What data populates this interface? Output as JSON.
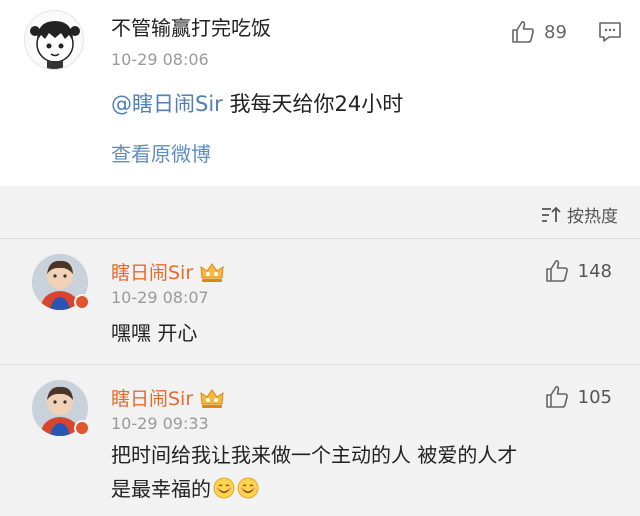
{
  "post": {
    "author": "不管输赢打完吃饭",
    "time": "10-29 08:06",
    "likes": "89",
    "mention": "@瞎日闹Sir",
    "body": " 我每天给你24小时",
    "view_original": "查看原微博"
  },
  "sort": {
    "label": "按热度"
  },
  "comments": [
    {
      "name": "瞎日闹Sir",
      "time": "10-29 08:07",
      "likes": "148",
      "text": "嘿嘿 开心"
    },
    {
      "name": "瞎日闹Sir",
      "time": "10-29 09:33",
      "likes": "105",
      "text_line1": "把时间给我让我来做一个主动的人 被爱的人才",
      "text_line2": "是最幸福的"
    }
  ],
  "colors": {
    "accent_link": "#5f8ec2",
    "username_orange": "#e66a2e",
    "background": "#f2f2f2"
  },
  "icons": [
    "thumbs-up-icon",
    "comment-icon",
    "sort-icon",
    "vip-crown-icon",
    "smile-emoji-icon"
  ]
}
